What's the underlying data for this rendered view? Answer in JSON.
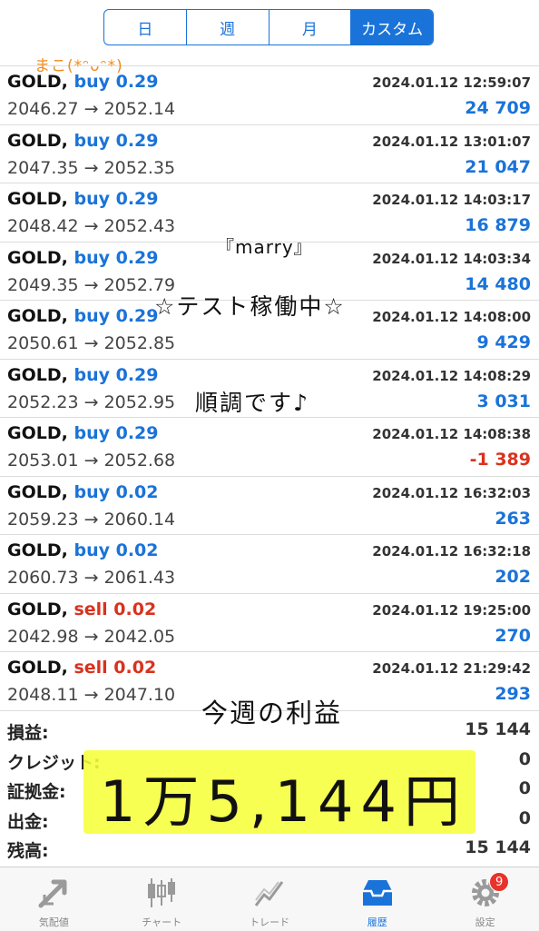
{
  "segments": [
    {
      "label": "日"
    },
    {
      "label": "週"
    },
    {
      "label": "月"
    },
    {
      "label": "カスタム"
    }
  ],
  "trades": [
    {
      "symbol": "GOLD,",
      "type": "buy",
      "lot": "buy 0.29",
      "datetime": "2024.01.12 12:59:07",
      "prices": "2046.27 → 2052.14",
      "profit": "24 709"
    },
    {
      "symbol": "GOLD,",
      "type": "buy",
      "lot": "buy 0.29",
      "datetime": "2024.01.12 13:01:07",
      "prices": "2047.35 → 2052.35",
      "profit": "21 047"
    },
    {
      "symbol": "GOLD,",
      "type": "buy",
      "lot": "buy 0.29",
      "datetime": "2024.01.12 14:03:17",
      "prices": "2048.42 → 2052.43",
      "profit": "16 879"
    },
    {
      "symbol": "GOLD,",
      "type": "buy",
      "lot": "buy 0.29",
      "datetime": "2024.01.12 14:03:34",
      "prices": "2049.35 → 2052.79",
      "profit": "14 480"
    },
    {
      "symbol": "GOLD,",
      "type": "buy",
      "lot": "buy 0.29",
      "datetime": "2024.01.12 14:08:00",
      "prices": "2050.61 → 2052.85",
      "profit": "9 429"
    },
    {
      "symbol": "GOLD,",
      "type": "buy",
      "lot": "buy 0.29",
      "datetime": "2024.01.12 14:08:29",
      "prices": "2052.23 → 2052.95",
      "profit": "3 031"
    },
    {
      "symbol": "GOLD,",
      "type": "buy",
      "lot": "buy 0.29",
      "datetime": "2024.01.12 14:08:38",
      "prices": "2053.01 → 2052.68",
      "profit": "-1 389"
    },
    {
      "symbol": "GOLD,",
      "type": "buy",
      "lot": "buy 0.02",
      "datetime": "2024.01.12 16:32:03",
      "prices": "2059.23 → 2060.14",
      "profit": "263"
    },
    {
      "symbol": "GOLD,",
      "type": "buy",
      "lot": "buy 0.02",
      "datetime": "2024.01.12 16:32:18",
      "prices": "2060.73 → 2061.43",
      "profit": "202"
    },
    {
      "symbol": "GOLD,",
      "type": "sell",
      "lot": "sell 0.02",
      "datetime": "2024.01.12 19:25:00",
      "prices": "2042.98 → 2042.05",
      "profit": "270"
    },
    {
      "symbol": "GOLD,",
      "type": "sell",
      "lot": "sell 0.02",
      "datetime": "2024.01.12 21:29:42",
      "prices": "2048.11 → 2047.10",
      "profit": "293"
    }
  ],
  "summary": [
    {
      "label": "損益:",
      "value": "15 144"
    },
    {
      "label": "クレジット:",
      "value": "0"
    },
    {
      "label": "証拠金:",
      "value": "0"
    },
    {
      "label": "出金:",
      "value": "0"
    },
    {
      "label": "残高:",
      "value": "15 144"
    }
  ],
  "tabs": [
    {
      "label": "気配値",
      "icon": "quotes-icon"
    },
    {
      "label": "チャート",
      "icon": "chart-icon"
    },
    {
      "label": "トレード",
      "icon": "trade-icon"
    },
    {
      "label": "履歴",
      "icon": "history-icon",
      "active": true
    },
    {
      "label": "設定",
      "icon": "settings-icon",
      "badge": "9"
    }
  ],
  "overlays": {
    "author": "まこ(*ᵔᴗᵔ*)",
    "marry": "『marry』",
    "test": "☆テスト稼働中☆",
    "smooth": "順調です♪",
    "week": "今週の利益",
    "amount": "1万5,144円"
  },
  "colors": {
    "accent": "#1a73d9",
    "sell": "#d9321e",
    "negative": "#d9321e",
    "highlight": "#f6ff3a",
    "badge": "#e8322a"
  }
}
